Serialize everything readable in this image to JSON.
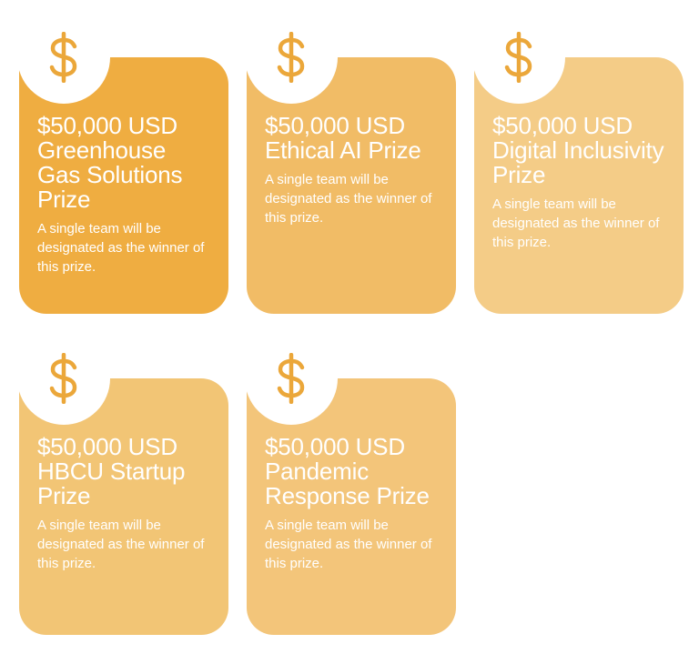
{
  "icon": "dollar-sign-icon",
  "colors": {
    "icon": "#eba73a",
    "badge": "#ffffff",
    "text": "#ffffff",
    "card_1": "#efad41",
    "card_2": "#f1bc66",
    "card_3": "#f4cc87",
    "card_4": "#f2c575",
    "card_5": "#f3c57a"
  },
  "prizes": [
    {
      "title": "$50,000 USD Greenhouse Gas Solutions Prize",
      "description": "A single team will be designated as the winner of this prize."
    },
    {
      "title": "$50,000 USD Ethical AI Prize",
      "description": "A single team will be designated as the winner of this prize."
    },
    {
      "title": "$50,000 USD Digital Inclusivity Prize",
      "description": "A single team will be designated as the winner of this prize."
    },
    {
      "title": "$50,000 USD HBCU Startup Prize",
      "description": "A single team will be designated as the winner of this prize."
    },
    {
      "title": "$50,000 USD Pandemic Response Prize",
      "description": "A single team will be designated as the winner of this prize."
    }
  ]
}
